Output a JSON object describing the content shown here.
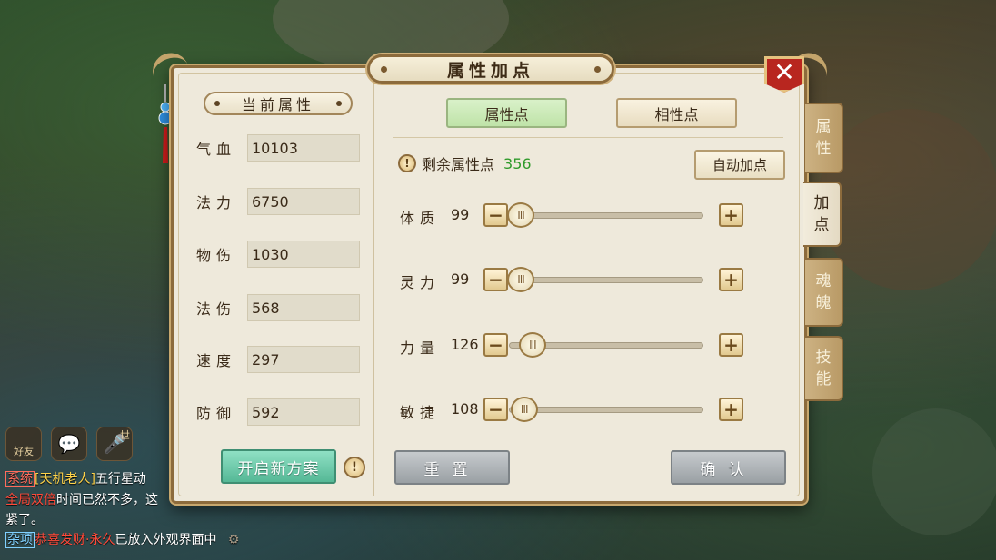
{
  "window": {
    "title": "属性加点",
    "close_icon": "close-icon"
  },
  "current_attributes": {
    "heading": "当前属性",
    "rows": [
      {
        "label": "气血",
        "value": "10103"
      },
      {
        "label": "法力",
        "value": "6750"
      },
      {
        "label": "物伤",
        "value": "1030"
      },
      {
        "label": "法伤",
        "value": "568"
      },
      {
        "label": "速度",
        "value": "297"
      },
      {
        "label": "防御",
        "value": "592"
      }
    ],
    "new_plan_label": "开启新方案",
    "info_icon": "!"
  },
  "tabs": {
    "attribute_points": "属性点",
    "affinity_points": "相性点",
    "selected": "属性点"
  },
  "remaining": {
    "icon": "!",
    "label": "剩余属性点",
    "value": "356"
  },
  "auto_button": "自动加点",
  "allocation": [
    {
      "label": "体质",
      "value": "99",
      "fraction": 0.0
    },
    {
      "label": "灵力",
      "value": "99",
      "fraction": 0.0
    },
    {
      "label": "力量",
      "value": "126",
      "fraction": 0.07
    },
    {
      "label": "敏捷",
      "value": "108",
      "fraction": 0.02
    }
  ],
  "stepper": {
    "minus": "−",
    "plus": "+",
    "thumb": "III"
  },
  "buttons": {
    "reset": "重置",
    "confirm": "确认"
  },
  "side_tabs": [
    {
      "label": "属性",
      "chars": [
        "属",
        "性"
      ],
      "active": false
    },
    {
      "label": "加点",
      "chars": [
        "加",
        "点"
      ],
      "active": true
    },
    {
      "label": "魂魄",
      "chars": [
        "魂",
        "魄"
      ],
      "active": false
    },
    {
      "label": "技能",
      "chars": [
        "技",
        "能"
      ],
      "active": false
    }
  ],
  "chat": {
    "friends_label": "好友",
    "world_label": "世",
    "lines": [
      {
        "tag": "系统",
        "parts": [
          {
            "text": "[天机老人]",
            "color": "yellow"
          },
          {
            "text": "五行星动",
            "color": "white"
          }
        ]
      },
      {
        "tag": "",
        "parts": [
          {
            "text": "全局双倍",
            "color": "red"
          },
          {
            "text": "时间已然不多，这",
            "color": "white"
          }
        ]
      },
      {
        "tag": "",
        "parts": [
          {
            "text": "紧了。",
            "color": "white"
          }
        ]
      },
      {
        "tag": "杂项",
        "parts": [
          {
            "text": "恭喜发财·永久",
            "color": "red"
          },
          {
            "text": "已放入外观界面中",
            "color": "white"
          }
        ]
      }
    ]
  },
  "colors": {
    "accent_green": "#2f9a2b",
    "close_red": "#b8261f",
    "panel_bg": "#eee9db"
  }
}
